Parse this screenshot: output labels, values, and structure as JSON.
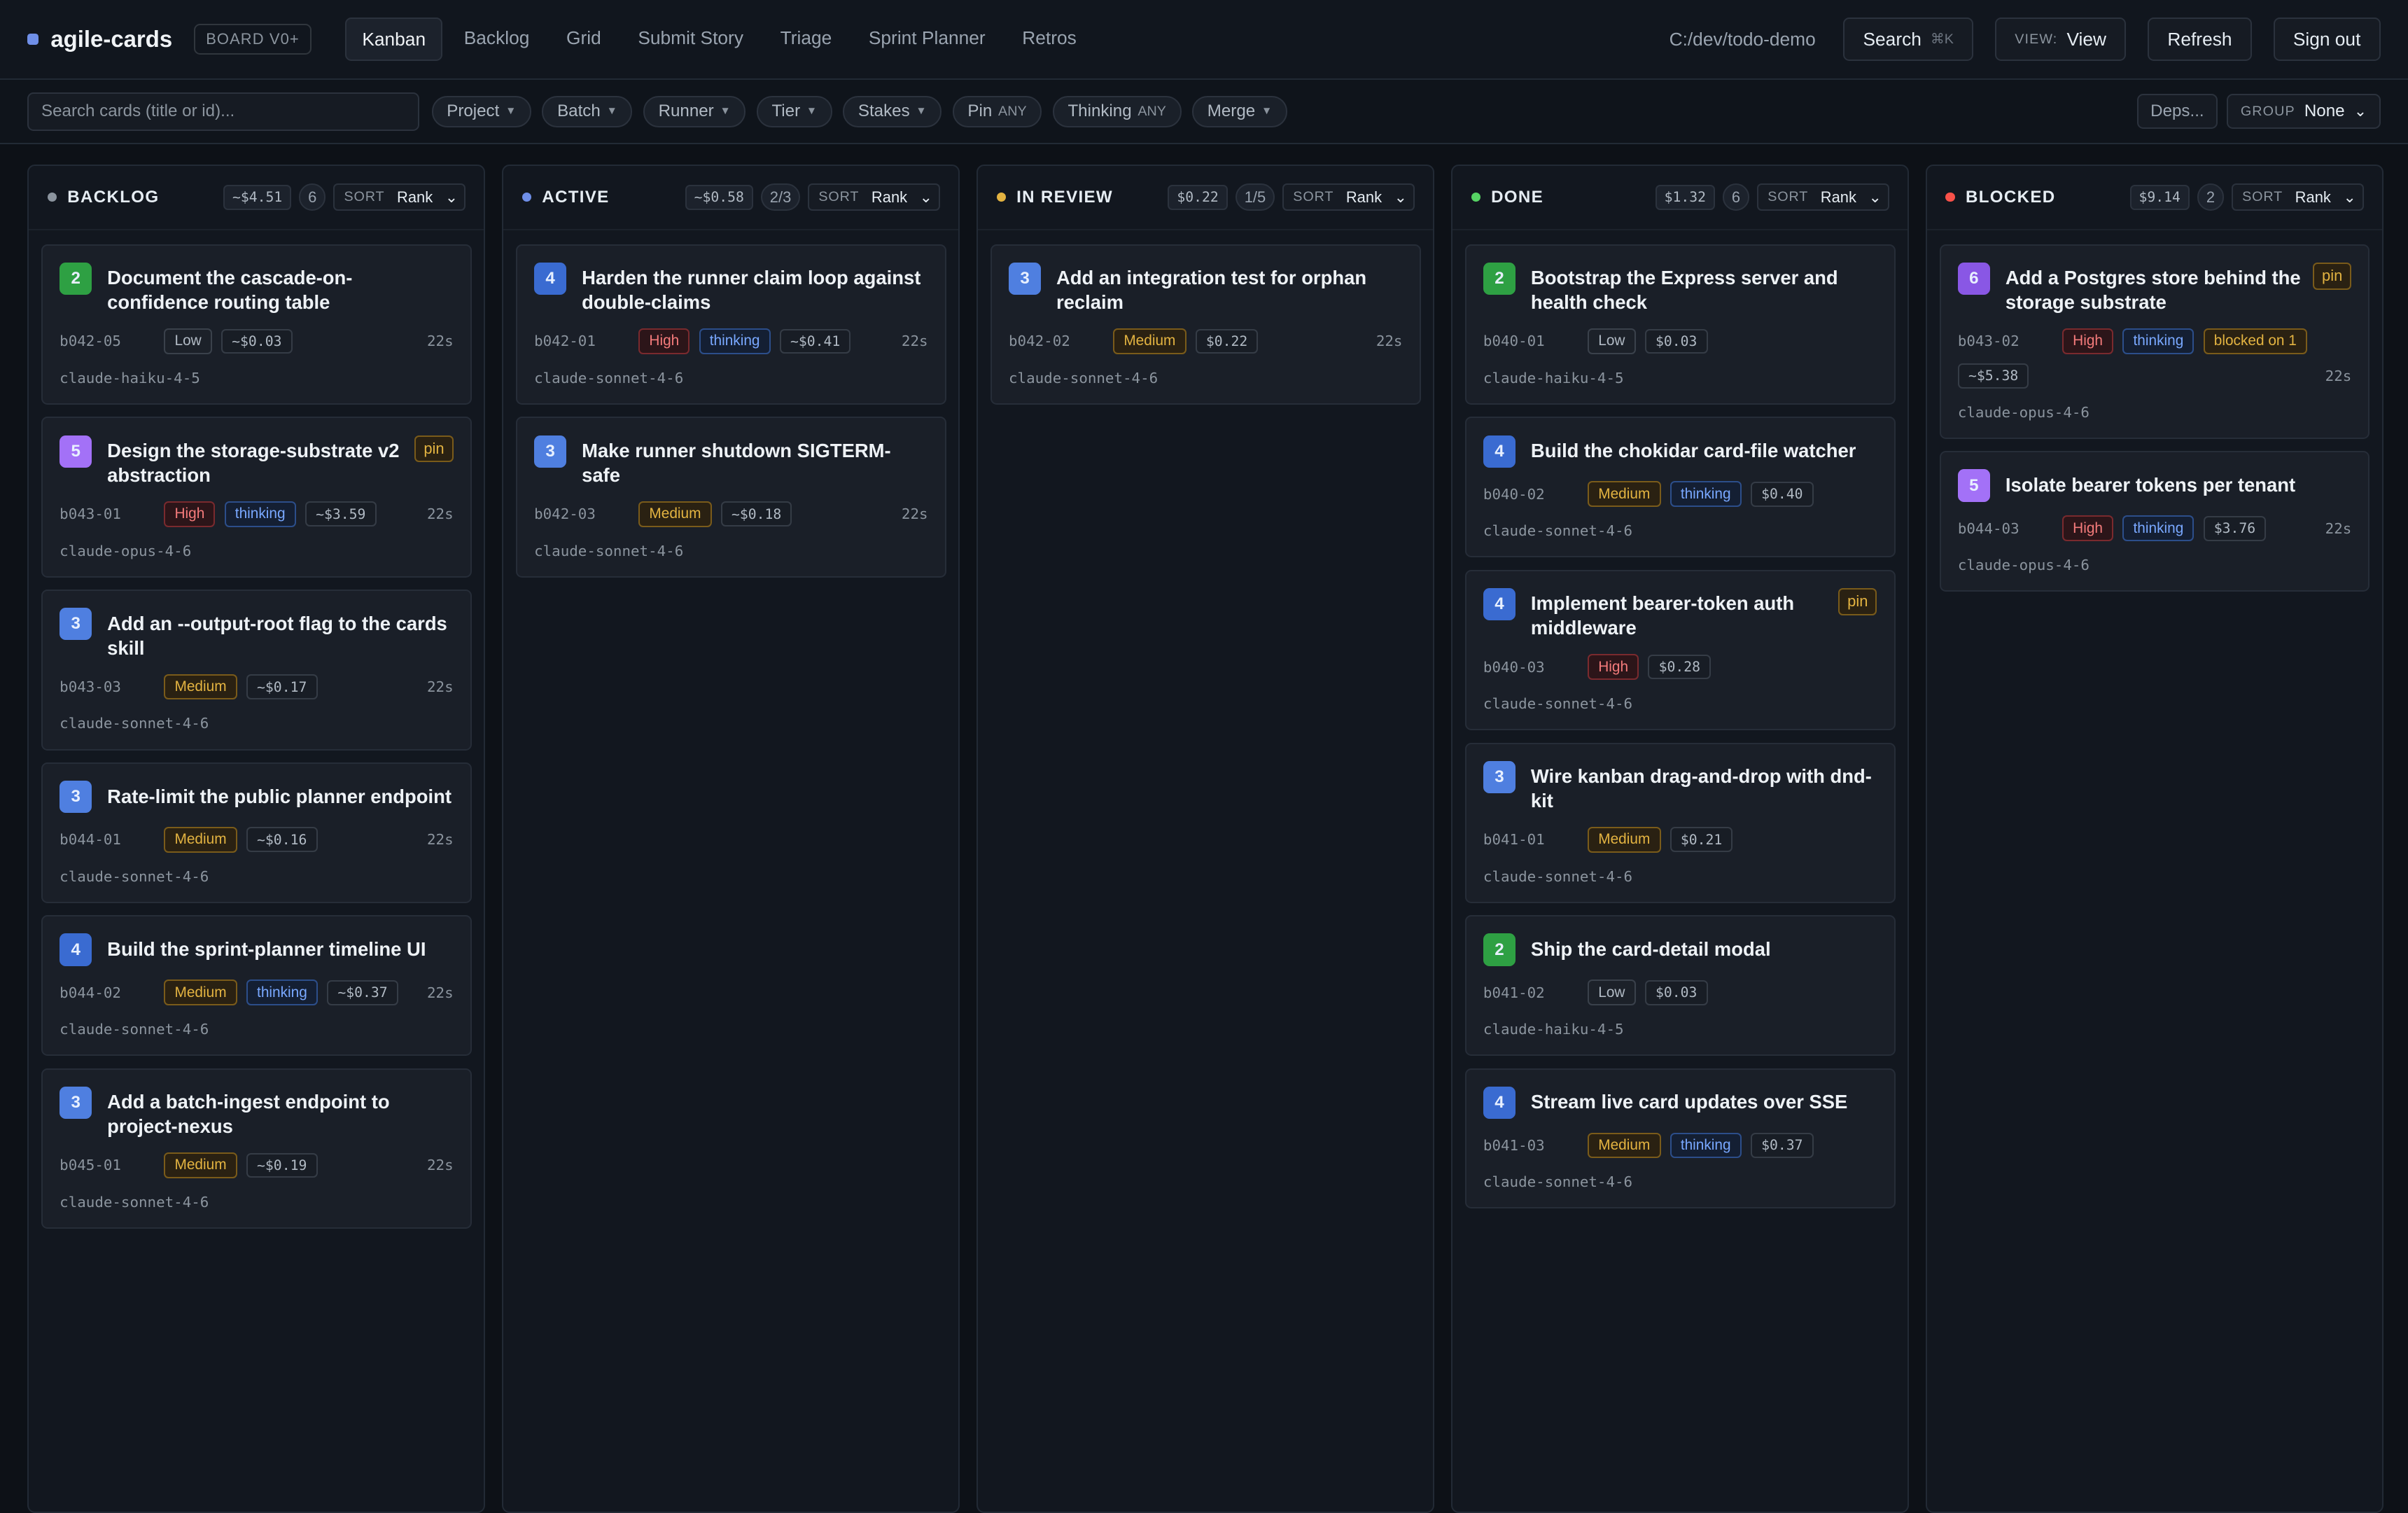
{
  "app": {
    "name": "agile-cards",
    "board_badge": "BOARD V0+"
  },
  "nav": [
    {
      "label": "Kanban",
      "active": true
    },
    {
      "label": "Backlog",
      "active": false
    },
    {
      "label": "Grid",
      "active": false
    },
    {
      "label": "Submit Story",
      "active": false
    },
    {
      "label": "Triage",
      "active": false
    },
    {
      "label": "Sprint Planner",
      "active": false
    },
    {
      "label": "Retros",
      "active": false
    }
  ],
  "topbar": {
    "path": "C:/dev/todo-demo",
    "search_label": "Search",
    "search_kbd": "⌘K",
    "view_label": "VIEW:",
    "view_value": "View",
    "refresh_label": "Refresh",
    "signout_label": "Sign out"
  },
  "filters": {
    "search_placeholder": "Search cards (title or id)...",
    "chips": [
      {
        "label": "Project",
        "sub": "",
        "chevron": true
      },
      {
        "label": "Batch",
        "sub": "",
        "chevron": true
      },
      {
        "label": "Runner",
        "sub": "",
        "chevron": true
      },
      {
        "label": "Tier",
        "sub": "",
        "chevron": true
      },
      {
        "label": "Stakes",
        "sub": "",
        "chevron": true
      },
      {
        "label": "Pin",
        "sub": "ANY",
        "chevron": false
      },
      {
        "label": "Thinking",
        "sub": "ANY",
        "chevron": false
      },
      {
        "label": "Merge",
        "sub": "",
        "chevron": true
      }
    ],
    "deps_label": "Deps...",
    "group_label": "GROUP",
    "group_value": "None"
  },
  "colors": {
    "pts_2": "#2ea043",
    "pts_3": "#4f7fe0",
    "pts_4": "#3a6bd1",
    "pts_5": "#a371f7",
    "pts_6": "#8957e5"
  },
  "columns": [
    {
      "title": "BACKLOG",
      "dot": "#8b949e",
      "cost": "~$4.51",
      "count": "6",
      "sort_label": "SORT",
      "sort_value": "Rank",
      "cards": [
        {
          "pts": "2",
          "title": "Document the cascade-on-confidence routing table",
          "pin": "",
          "id": "b042-05",
          "tags": [
            {
              "t": "Low",
              "c": "low"
            }
          ],
          "cost": "~$0.03",
          "age": "22s",
          "model": "claude-haiku-4-5"
        },
        {
          "pts": "5",
          "title": "Design the storage-substrate v2 abstraction",
          "pin": "pin",
          "id": "b043-01",
          "tags": [
            {
              "t": "High",
              "c": "high"
            },
            {
              "t": "thinking",
              "c": "thinking"
            }
          ],
          "cost": "~$3.59",
          "age": "22s",
          "model": "claude-opus-4-6"
        },
        {
          "pts": "3",
          "title": "Add an --output-root flag to the cards skill",
          "pin": "",
          "id": "b043-03",
          "tags": [
            {
              "t": "Medium",
              "c": "medium"
            }
          ],
          "cost": "~$0.17",
          "age": "22s",
          "model": "claude-sonnet-4-6"
        },
        {
          "pts": "3",
          "title": "Rate-limit the public planner endpoint",
          "pin": "",
          "id": "b044-01",
          "tags": [
            {
              "t": "Medium",
              "c": "medium"
            }
          ],
          "cost": "~$0.16",
          "age": "22s",
          "model": "claude-sonnet-4-6"
        },
        {
          "pts": "4",
          "title": "Build the sprint-planner timeline UI",
          "pin": "",
          "id": "b044-02",
          "tags": [
            {
              "t": "Medium",
              "c": "medium"
            },
            {
              "t": "thinking",
              "c": "thinking"
            }
          ],
          "cost": "~$0.37",
          "age": "22s",
          "model": "claude-sonnet-4-6"
        },
        {
          "pts": "3",
          "title": "Add a batch-ingest endpoint to project-nexus",
          "pin": "",
          "id": "b045-01",
          "tags": [
            {
              "t": "Medium",
              "c": "medium"
            }
          ],
          "cost": "~$0.19",
          "age": "22s",
          "model": "claude-sonnet-4-6"
        }
      ]
    },
    {
      "title": "ACTIVE",
      "dot": "#6f8fe8",
      "cost": "~$0.58",
      "count": "2/3",
      "sort_label": "SORT",
      "sort_value": "Rank",
      "cards": [
        {
          "pts": "4",
          "title": "Harden the runner claim loop against double-claims",
          "pin": "",
          "id": "b042-01",
          "tags": [
            {
              "t": "High",
              "c": "high"
            },
            {
              "t": "thinking",
              "c": "thinking"
            }
          ],
          "cost": "~$0.41",
          "age": "22s",
          "model": "claude-sonnet-4-6"
        },
        {
          "pts": "3",
          "title": "Make runner shutdown SIGTERM-safe",
          "pin": "",
          "id": "b042-03",
          "tags": [
            {
              "t": "Medium",
              "c": "medium"
            }
          ],
          "cost": "~$0.18",
          "age": "22s",
          "model": "claude-sonnet-4-6"
        }
      ]
    },
    {
      "title": "IN REVIEW",
      "dot": "#e3b341",
      "cost": "$0.22",
      "count": "1/5",
      "sort_label": "SORT",
      "sort_value": "Rank",
      "cards": [
        {
          "pts": "3",
          "title": "Add an integration test for orphan reclaim",
          "pin": "",
          "id": "b042-02",
          "tags": [
            {
              "t": "Medium",
              "c": "medium"
            }
          ],
          "cost": "$0.22",
          "age": "22s",
          "model": "claude-sonnet-4-6"
        }
      ]
    },
    {
      "title": "DONE",
      "dot": "#56d364",
      "cost": "$1.32",
      "count": "6",
      "sort_label": "SORT",
      "sort_value": "Rank",
      "cards": [
        {
          "pts": "2",
          "title": "Bootstrap the Express server and health check",
          "pin": "",
          "id": "b040-01",
          "tags": [
            {
              "t": "Low",
              "c": "low"
            }
          ],
          "cost": "$0.03",
          "age": "",
          "model": "claude-haiku-4-5"
        },
        {
          "pts": "4",
          "title": "Build the chokidar card-file watcher",
          "pin": "",
          "id": "b040-02",
          "tags": [
            {
              "t": "Medium",
              "c": "medium"
            },
            {
              "t": "thinking",
              "c": "thinking"
            }
          ],
          "cost": "$0.40",
          "age": "",
          "model": "claude-sonnet-4-6"
        },
        {
          "pts": "4",
          "title": "Implement bearer-token auth middleware",
          "pin": "pin",
          "id": "b040-03",
          "tags": [
            {
              "t": "High",
              "c": "high"
            }
          ],
          "cost": "$0.28",
          "age": "",
          "model": "claude-sonnet-4-6"
        },
        {
          "pts": "3",
          "title": "Wire kanban drag-and-drop with dnd-kit",
          "pin": "",
          "id": "b041-01",
          "tags": [
            {
              "t": "Medium",
              "c": "medium"
            }
          ],
          "cost": "$0.21",
          "age": "",
          "model": "claude-sonnet-4-6"
        },
        {
          "pts": "2",
          "title": "Ship the card-detail modal",
          "pin": "",
          "id": "b041-02",
          "tags": [
            {
              "t": "Low",
              "c": "low"
            }
          ],
          "cost": "$0.03",
          "age": "",
          "model": "claude-haiku-4-5"
        },
        {
          "pts": "4",
          "title": "Stream live card updates over SSE",
          "pin": "",
          "id": "b041-03",
          "tags": [
            {
              "t": "Medium",
              "c": "medium"
            },
            {
              "t": "thinking",
              "c": "thinking"
            }
          ],
          "cost": "$0.37",
          "age": "",
          "model": "claude-sonnet-4-6"
        }
      ]
    },
    {
      "title": "BLOCKED",
      "dot": "#f85149",
      "cost": "$9.14",
      "count": "2",
      "sort_label": "SORT",
      "sort_value": "Rank",
      "cards": [
        {
          "pts": "6",
          "title": "Add a Postgres store behind the storage substrate",
          "pin": "pin",
          "id": "b043-02",
          "tags": [
            {
              "t": "High",
              "c": "high"
            },
            {
              "t": "thinking",
              "c": "thinking"
            },
            {
              "t": "blocked on 1",
              "c": "blocked"
            }
          ],
          "cost": "~$5.38",
          "age": "22s",
          "model": "claude-opus-4-6"
        },
        {
          "pts": "5",
          "title": "Isolate bearer tokens per tenant",
          "pin": "",
          "id": "b044-03",
          "tags": [
            {
              "t": "High",
              "c": "high"
            },
            {
              "t": "thinking",
              "c": "thinking"
            }
          ],
          "cost": "$3.76",
          "age": "22s",
          "model": "claude-opus-4-6"
        }
      ]
    }
  ]
}
